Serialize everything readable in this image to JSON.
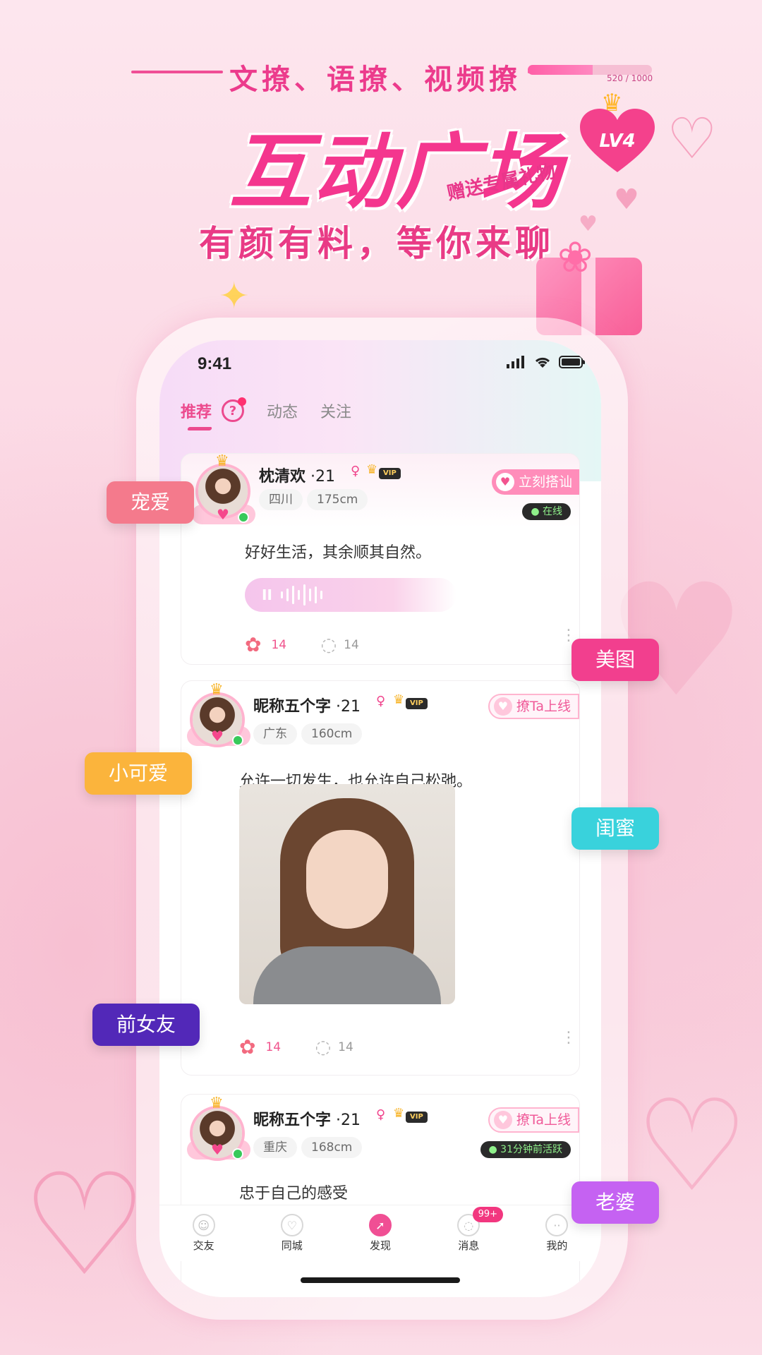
{
  "hero": {
    "slogan": "文撩、语撩、视频撩",
    "title": "互动广场",
    "subtitle": "有颜有料，等你来聊",
    "gift_tag": "赠送专属礼物",
    "level": {
      "badge": "LV4",
      "progress_text": "520 / 1000",
      "progress_fraction": 0.52
    }
  },
  "status_bar": {
    "time": "9:41"
  },
  "tabs": [
    {
      "label": "推荐",
      "active": true
    },
    {
      "label": "动态",
      "active": false
    },
    {
      "label": "关注",
      "active": false
    }
  ],
  "help_icon": "?",
  "posts": [
    {
      "name": "枕清欢",
      "age": " ·21",
      "vip": "VIP",
      "tags": [
        "四川",
        "175cm"
      ],
      "action": "立刻搭讪",
      "status": "● 在线",
      "text": "好好生活，其余顺其自然。",
      "likes": "14",
      "comments": "14"
    },
    {
      "name": "昵称五个字",
      "age": " ·21",
      "vip": "VIP",
      "tags": [
        "广东",
        "160cm"
      ],
      "action": "撩Ta上线",
      "text": "允许一切发生，也允许自己松弛。",
      "likes": "14",
      "comments": "14"
    },
    {
      "name": "昵称五个字",
      "age": " ·21",
      "vip": "VIP",
      "tags": [
        "重庆",
        "168cm"
      ],
      "action": "撩Ta上线",
      "status": "● 31分钟前活跃",
      "text": "忠于自己的感受"
    }
  ],
  "bottom_nav": [
    {
      "label": "交友",
      "icon": "friends-icon"
    },
    {
      "label": "同城",
      "icon": "nearby-icon"
    },
    {
      "label": "发现",
      "icon": "discover-icon",
      "active": true
    },
    {
      "label": "消息",
      "icon": "message-icon",
      "badge": "99+"
    },
    {
      "label": "我的",
      "icon": "profile-icon"
    }
  ],
  "floating_tags": [
    {
      "label": "宠爱",
      "color": "#f47a8c"
    },
    {
      "label": "美图",
      "color": "#f23f8e"
    },
    {
      "label": "小可爱",
      "color": "#fbb43c"
    },
    {
      "label": "闺蜜",
      "color": "#39d2dc"
    },
    {
      "label": "前女友",
      "color": "#5228b8"
    },
    {
      "label": "老婆",
      "color": "#c562f2"
    }
  ]
}
